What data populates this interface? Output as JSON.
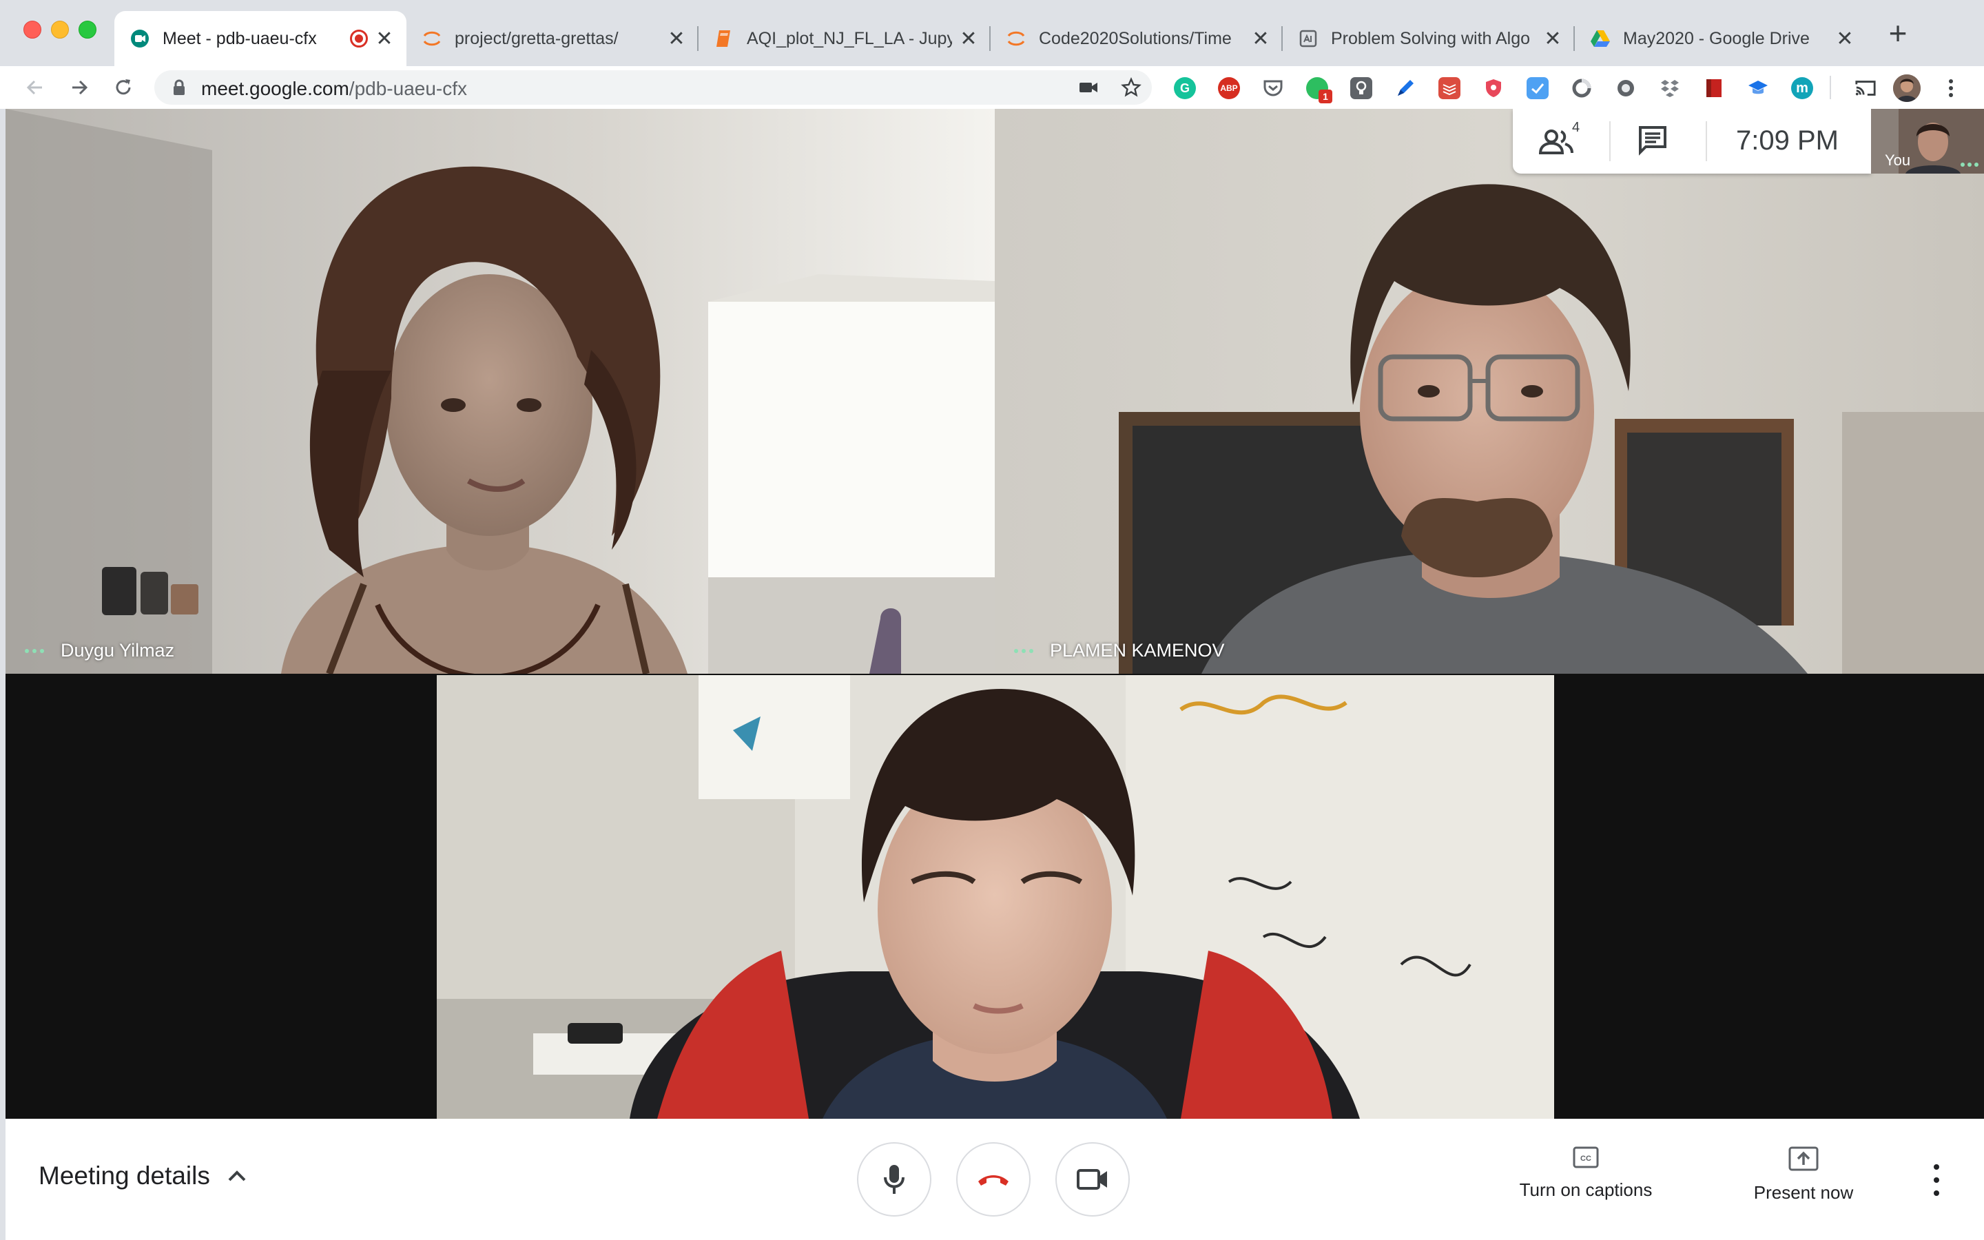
{
  "browser": {
    "tabs": [
      {
        "title": "Meet - pdb-uaeu-cfx",
        "favicon": "google-meet-icon",
        "active": true,
        "recording": true
      },
      {
        "title": "project/gretta-grettas/",
        "favicon": "jupyter-icon"
      },
      {
        "title": "AQI_plot_NJ_FL_LA - Jupy",
        "favicon": "notebook-icon"
      },
      {
        "title": "Code2020Solutions/Time",
        "favicon": "jupyter-icon"
      },
      {
        "title": "Problem Solving with Algo",
        "favicon": "document-icon"
      },
      {
        "title": "May2020 - Google Drive",
        "favicon": "google-drive-icon"
      }
    ],
    "new_tab_label": "+",
    "close_glyph": "✕",
    "url": {
      "host": "meet.google.com",
      "path": "/pdb-uaeu-cfx"
    },
    "extension_icons": [
      {
        "name": "grammarly-icon",
        "label": "G",
        "color": "#15c39a"
      },
      {
        "name": "adblock-plus-icon",
        "label": "ABP",
        "color": "#d62d20"
      },
      {
        "name": "pocket-icon",
        "label": "",
        "color": "#5f6368"
      },
      {
        "name": "evernote-icon",
        "label": "1",
        "color": "#2dbe60"
      },
      {
        "name": "lightbulb-icon",
        "label": "",
        "color": "#5f6368"
      },
      {
        "name": "pen-icon",
        "label": "",
        "color": "#1a73e8"
      },
      {
        "name": "todoist-icon",
        "label": "",
        "color": "#db4c3f"
      },
      {
        "name": "shield-icon",
        "label": "",
        "color": "#e8475a"
      },
      {
        "name": "checkmark-icon",
        "label": "",
        "color": "#4ea1f3"
      },
      {
        "name": "circle-ring-icon",
        "label": "",
        "color": "#5f6368"
      },
      {
        "name": "disc-icon",
        "label": "",
        "color": "#5f6368"
      },
      {
        "name": "dropbox-icon",
        "label": "",
        "color": "#7a7f85"
      },
      {
        "name": "bookmark-red-icon",
        "label": "",
        "color": "#c5221f"
      },
      {
        "name": "graduation-cap-icon",
        "label": "",
        "color": "#1a73e8"
      },
      {
        "name": "m-circle-icon",
        "label": "m",
        "color": "#12a4b8"
      }
    ]
  },
  "meet": {
    "participants": [
      {
        "name": "Duygu Yilmaz"
      },
      {
        "name": "PLAMEN KAMENOV"
      },
      {
        "name": ""
      }
    ],
    "people_count": "4",
    "time": "7:09 PM",
    "self_label": "You",
    "meeting_details": "Meeting details",
    "captions_label": "Turn on captions",
    "present_label": "Present now",
    "colors": {
      "end_call": "#d93025",
      "speaking_dots": "#8ee0b5"
    }
  }
}
